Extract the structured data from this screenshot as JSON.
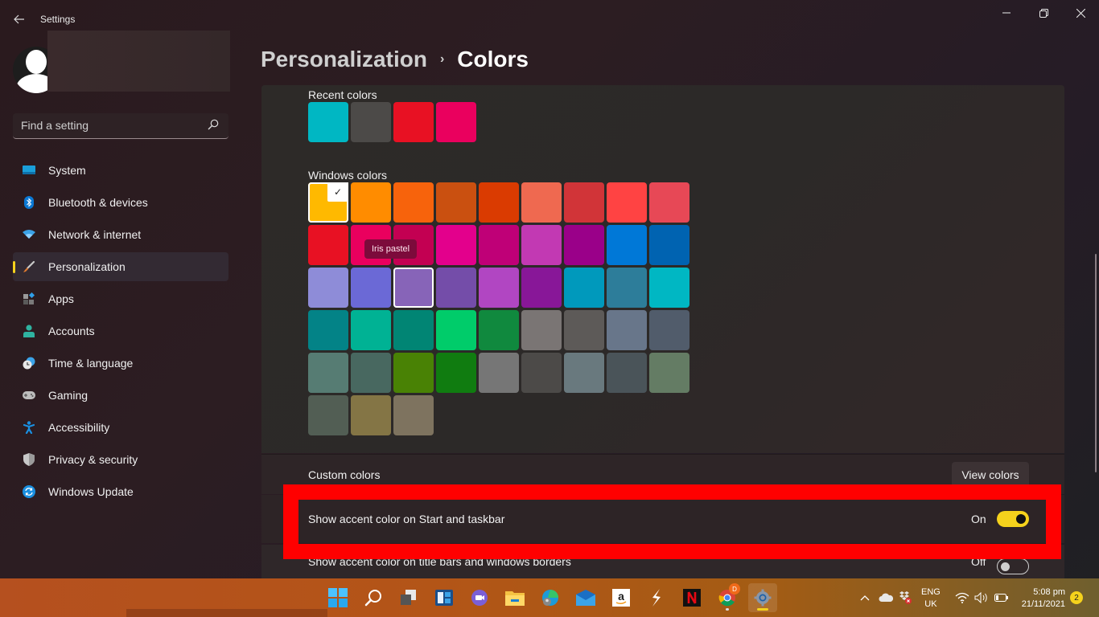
{
  "window": {
    "title": "Settings",
    "controls": {
      "minimize": "—",
      "maximize": "❐",
      "close": "✕"
    }
  },
  "search": {
    "placeholder": "Find a setting",
    "value": ""
  },
  "sidebar": {
    "active": "Personalization",
    "accent_color": "#f5d21c",
    "items": [
      {
        "label": "System",
        "icon": "monitor-icon",
        "color": "#1a9fd9"
      },
      {
        "label": "Bluetooth & devices",
        "icon": "bluetooth-icon",
        "color": "#0a78d4"
      },
      {
        "label": "Network & internet",
        "icon": "wifi-icon",
        "color": "#3ba3e8"
      },
      {
        "label": "Personalization",
        "icon": "paintbrush-icon",
        "color": "#e07b30"
      },
      {
        "label": "Apps",
        "icon": "apps-icon",
        "color": "#8a8a8a"
      },
      {
        "label": "Accounts",
        "icon": "person-icon",
        "color": "#2fb3a0"
      },
      {
        "label": "Time & language",
        "icon": "clock-globe-icon",
        "color": "#3ba3e8"
      },
      {
        "label": "Gaming",
        "icon": "gamepad-icon",
        "color": "#bdbdbd"
      },
      {
        "label": "Accessibility",
        "icon": "accessibility-icon",
        "color": "#1a8fe0"
      },
      {
        "label": "Privacy & security",
        "icon": "shield-icon",
        "color": "#c8c8c8"
      },
      {
        "label": "Windows Update",
        "icon": "update-icon",
        "color": "#1a8fe0"
      }
    ]
  },
  "header": {
    "parent": "Personalization",
    "separator": "›",
    "current": "Colors"
  },
  "recent_colors": {
    "label": "Recent colors",
    "swatches": [
      "#00b7c3",
      "#4c4a48",
      "#e81123",
      "#ea005e"
    ]
  },
  "windows_colors": {
    "label": "Windows colors",
    "selected_index": 0,
    "hover_index": 20,
    "tooltip": "Iris pastel",
    "swatches": [
      "#ffb900",
      "#ff8c00",
      "#f7630c",
      "#ca5010",
      "#da3b01",
      "#ef6950",
      "#d13438",
      "#ff4343",
      "#e74856",
      "#e81123",
      "#ea005e",
      "#c30052",
      "#e3008c",
      "#bf0077",
      "#c239b3",
      "#9a0089",
      "#0078d7",
      "#0063b1",
      "#8e8cd8",
      "#6b69d6",
      "#8764b8",
      "#744da9",
      "#b146c2",
      "#881798",
      "#0099bc",
      "#2d7d9a",
      "#00b7c3",
      "#038387",
      "#00b294",
      "#018574",
      "#00cc6a",
      "#10893e",
      "#7a7574",
      "#5d5a58",
      "#68768a",
      "#515c6b",
      "#567c73",
      "#486860",
      "#498205",
      "#107c10",
      "#767676",
      "#4c4a48",
      "#69797e",
      "#4a5459",
      "#647c64",
      "#525e54",
      "#847545",
      "#7e735f"
    ]
  },
  "custom_colors": {
    "label": "Custom colors",
    "button": "View colors"
  },
  "settings": {
    "accent_start_taskbar": {
      "label": "Show accent color on Start and taskbar",
      "state": "On",
      "on": true
    },
    "accent_title_bars": {
      "label": "Show accent color on title bars and windows borders",
      "state": "Off",
      "on": false
    }
  },
  "taskbar": {
    "apps": [
      {
        "name": "start",
        "icon": "windows-start-icon"
      },
      {
        "name": "search",
        "icon": "search-icon"
      },
      {
        "name": "task-view",
        "icon": "task-view-icon"
      },
      {
        "name": "widgets",
        "icon": "widgets-icon"
      },
      {
        "name": "teams-chat",
        "icon": "chat-icon"
      },
      {
        "name": "file-explorer",
        "icon": "folder-icon"
      },
      {
        "name": "edge",
        "icon": "edge-icon"
      },
      {
        "name": "mail",
        "icon": "mail-icon"
      },
      {
        "name": "amazon",
        "icon": "amazon-icon",
        "glyph": "a"
      },
      {
        "name": "app-lightning",
        "icon": "lightning-icon"
      },
      {
        "name": "netflix",
        "icon": "netflix-icon",
        "glyph": "N"
      },
      {
        "name": "chrome",
        "icon": "chrome-icon",
        "badge": "D"
      },
      {
        "name": "settings",
        "icon": "gear-icon",
        "active": true
      }
    ],
    "tray": {
      "language": "ENG",
      "region": "UK",
      "time": "5:08 pm",
      "date": "21/11/2021",
      "notifications": "2"
    }
  }
}
